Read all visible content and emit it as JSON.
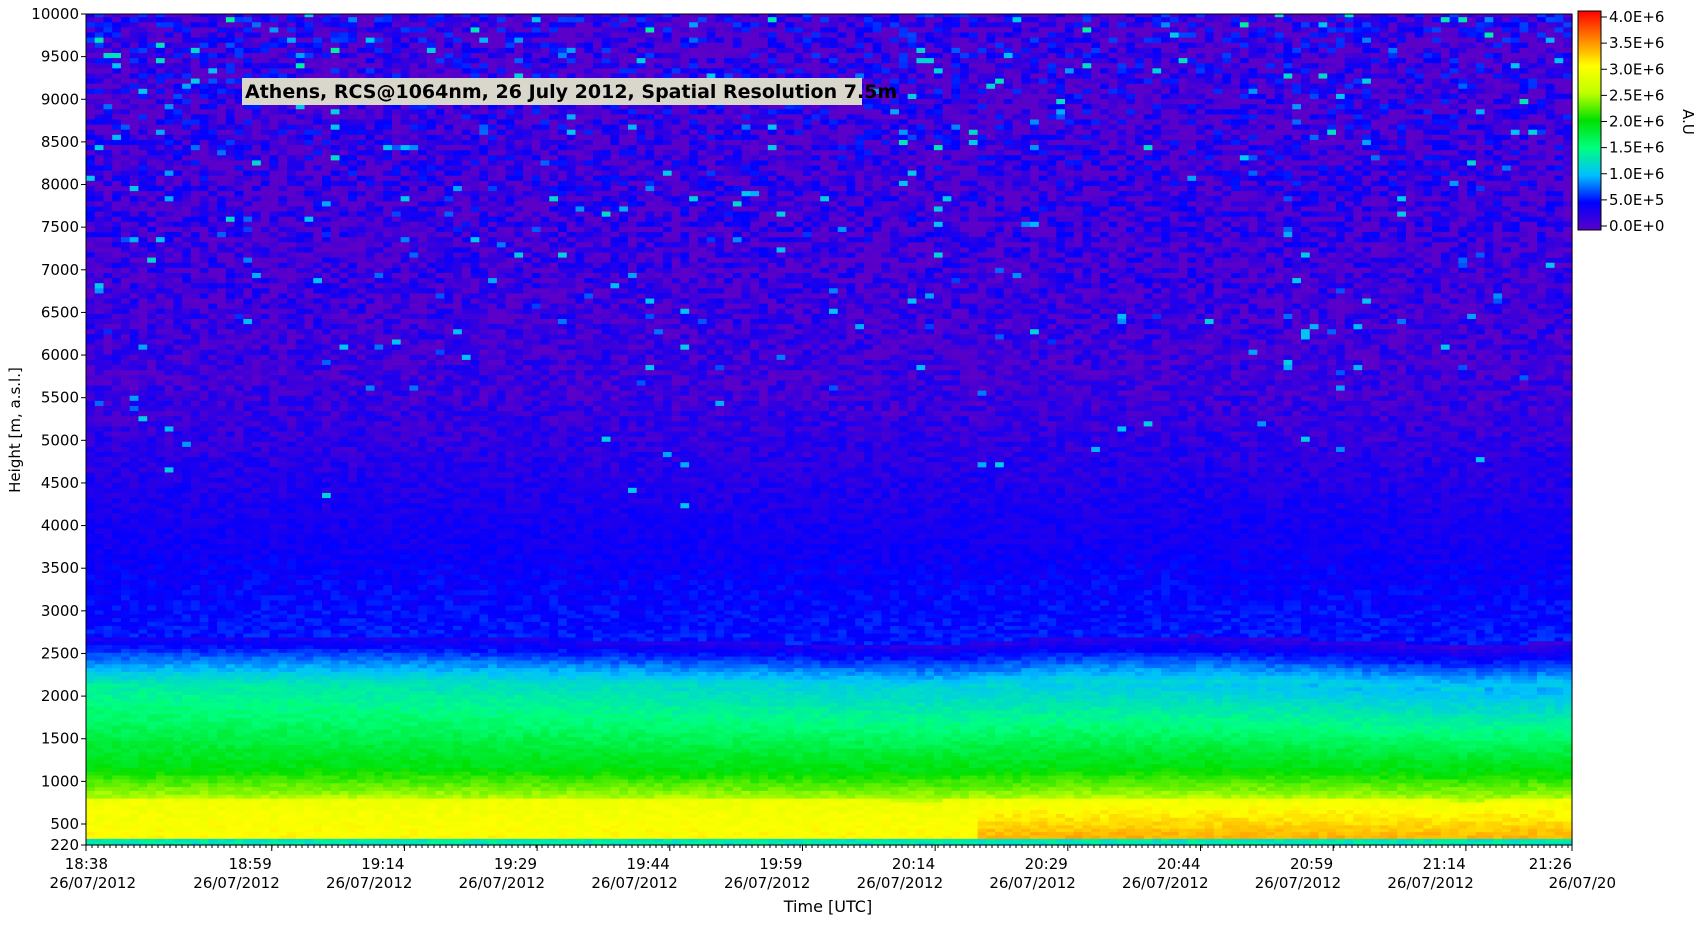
{
  "chart_data": {
    "type": "heatmap",
    "title": "Athens, RCS@1064nm, 26 July 2012, Spatial Resolution 7.5m",
    "xlabel": "Time [UTC]",
    "ylabel": "Height [m, a.s.l.]",
    "ylim": [
      220,
      10000
    ],
    "x_range": [
      "18:38",
      "21:26"
    ],
    "x_ticks": [
      {
        "time": "18:38",
        "date": "26/07/2012"
      },
      {
        "time": "18:59",
        "date": "26/07/2012"
      },
      {
        "time": "19:14",
        "date": "26/07/2012"
      },
      {
        "time": "19:29",
        "date": "26/07/2012"
      },
      {
        "time": "19:44",
        "date": "26/07/2012"
      },
      {
        "time": "19:59",
        "date": "26/07/2012"
      },
      {
        "time": "20:14",
        "date": "26/07/2012"
      },
      {
        "time": "20:29",
        "date": "26/07/2012"
      },
      {
        "time": "20:44",
        "date": "26/07/2012"
      },
      {
        "time": "20:59",
        "date": "26/07/2012"
      },
      {
        "time": "21:14",
        "date": "26/07/2012"
      },
      {
        "time": "21:26",
        "date": "26/07/20"
      }
    ],
    "y_ticks": [
      220,
      500,
      1000,
      1500,
      2000,
      2500,
      3000,
      3500,
      4000,
      4500,
      5000,
      5500,
      6000,
      6500,
      7000,
      7500,
      8000,
      8500,
      9000,
      9500,
      10000
    ],
    "colorbar": {
      "label": "A.U",
      "min": 0,
      "max": 4000000,
      "ticks": [
        "0.0E+0",
        "5.0E+5",
        "1.0E+6",
        "1.5E+6",
        "2.0E+6",
        "2.5E+6",
        "3.0E+6",
        "3.5E+6",
        "4.0E+6"
      ],
      "tick_values": [
        0,
        500000,
        1000000,
        1500000,
        2000000,
        2500000,
        3000000,
        3500000,
        4000000
      ],
      "colors": [
        "#5a00c8",
        "#0000ff",
        "#00bfff",
        "#00ff7f",
        "#00e000",
        "#bfff00",
        "#ffff00",
        "#ff8000",
        "#ff0000"
      ]
    },
    "boundary_layer_top_m": [
      {
        "time": "18:38",
        "height": 2680
      },
      {
        "time": "19:14",
        "height": 2700
      },
      {
        "time": "19:44",
        "height": 2650
      },
      {
        "time": "20:14",
        "height": 2600
      },
      {
        "time": "20:29",
        "height": 2700
      },
      {
        "time": "20:44",
        "height": 2720
      },
      {
        "time": "21:14",
        "height": 2600
      },
      {
        "time": "21:26",
        "height": 2650
      }
    ],
    "grid": false,
    "legend": "colorbar-right"
  }
}
